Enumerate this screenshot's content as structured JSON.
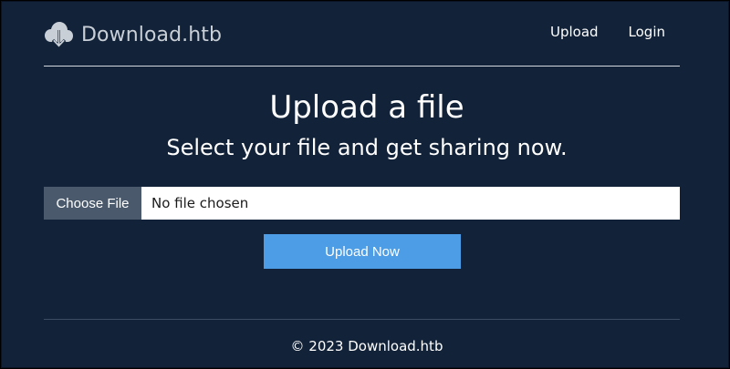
{
  "brand": {
    "name": "Download.htb",
    "icon": "cloud-download-icon"
  },
  "nav": {
    "upload": "Upload",
    "login": "Login"
  },
  "hero": {
    "title": "Upload a file",
    "subtitle": "Select your file and get sharing now."
  },
  "file_input": {
    "button_label": "Choose File",
    "status": "No file chosen"
  },
  "actions": {
    "upload_now": "Upload Now"
  },
  "footer": {
    "copyright": "© 2023 Download.htb"
  },
  "colors": {
    "background": "#122238",
    "primary_button": "#4d9ce6",
    "file_button": "#4a596b",
    "brand_text": "#c9cfd7"
  }
}
